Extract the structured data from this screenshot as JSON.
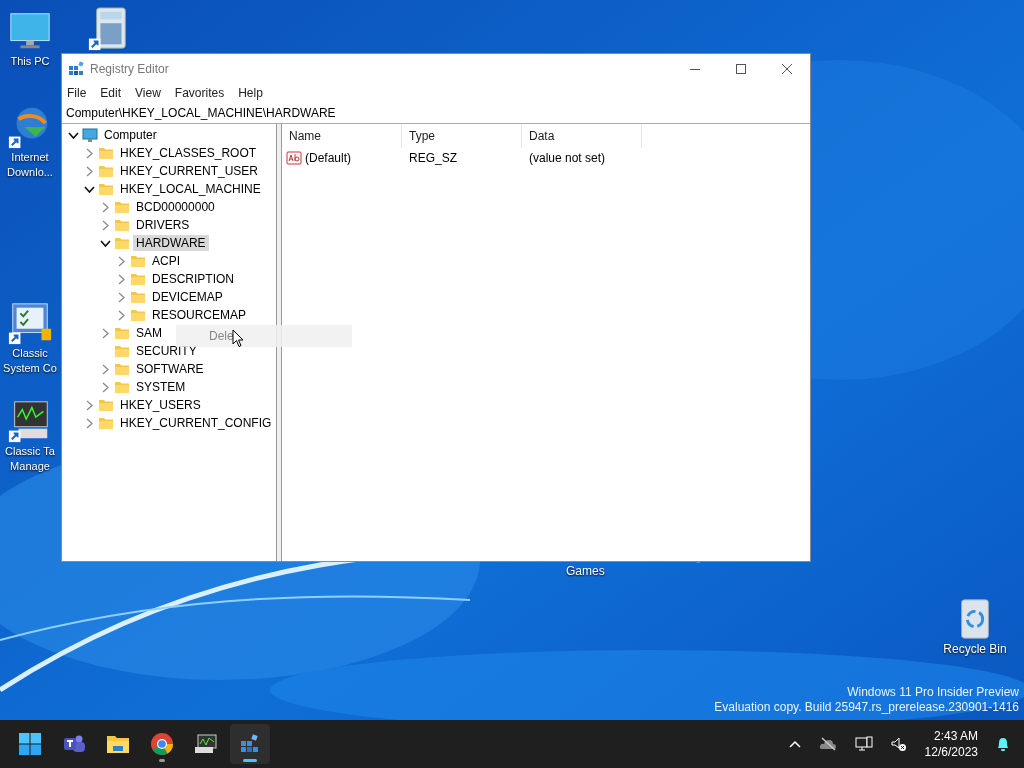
{
  "desktop_icons": [
    {
      "kind": "monitor",
      "lines": [
        "This PC"
      ]
    },
    {
      "kind": "calculator"
    },
    {
      "kind": "download",
      "lines": [
        "Internet",
        "Downlo..."
      ]
    },
    {
      "kind": "control",
      "lines": [
        "Classic",
        "System Co"
      ]
    },
    {
      "kind": "taskmgr",
      "lines": [
        "Classic Ta",
        "Manage"
      ]
    }
  ],
  "games_label": "Games",
  "recycle_bin": {
    "label": "Recycle Bin"
  },
  "watermark": [
    "Windows 11 Pro Insider Preview",
    "Evaluation copy. Build 25947.rs_prerelease.230901-1416"
  ],
  "window": {
    "title": "Registry Editor",
    "menu": [
      "File",
      "Edit",
      "View",
      "Favorites",
      "Help"
    ],
    "address": "Computer\\HKEY_LOCAL_MACHINE\\HARDWARE",
    "tree": {
      "items": [
        {
          "label": "Computer",
          "kind": "computer",
          "expanded": true,
          "selected": false,
          "children": [
            {
              "label": "HKEY_CLASSES_ROOT",
              "kind": "folder",
              "expanded": false,
              "selected": false
            },
            {
              "label": "HKEY_CURRENT_USER",
              "kind": "folder",
              "expanded": false,
              "selected": false
            },
            {
              "label": "HKEY_LOCAL_MACHINE",
              "kind": "folder",
              "expanded": true,
              "selected": false,
              "children": [
                {
                  "label": "BCD00000000",
                  "kind": "folder",
                  "expanded": false,
                  "selected": false
                },
                {
                  "label": "DRIVERS",
                  "kind": "folder",
                  "expanded": false,
                  "selected": false
                },
                {
                  "label": "HARDWARE",
                  "kind": "folder",
                  "expanded": true,
                  "selected": true,
                  "children": [
                    {
                      "label": "ACPI",
                      "kind": "folder",
                      "expanded": false,
                      "selected": false
                    },
                    {
                      "label": "DESCRIPTION",
                      "kind": "folder",
                      "expanded": false,
                      "selected": false
                    },
                    {
                      "label": "DEVICEMAP",
                      "kind": "folder",
                      "expanded": false,
                      "selected": false
                    },
                    {
                      "label": "RESOURCEMAP",
                      "kind": "folder",
                      "expanded": false,
                      "selected": false
                    }
                  ]
                },
                {
                  "label": "SAM",
                  "kind": "folder",
                  "expanded": false,
                  "selected": false
                },
                {
                  "label": "SECURITY",
                  "kind": "leaf",
                  "selected": false
                },
                {
                  "label": "SOFTWARE",
                  "kind": "folder",
                  "expanded": false,
                  "selected": false
                },
                {
                  "label": "SYSTEM",
                  "kind": "folder",
                  "expanded": false,
                  "selected": false
                }
              ]
            },
            {
              "label": "HKEY_USERS",
              "kind": "folder",
              "expanded": false,
              "selected": false
            },
            {
              "label": "HKEY_CURRENT_CONFIG",
              "kind": "folder",
              "expanded": false,
              "selected": false
            }
          ]
        }
      ]
    },
    "drag_ghost": {
      "text": "Dele"
    },
    "table": {
      "columns": [
        "Name",
        "Type",
        "Data"
      ],
      "rows": [
        {
          "kind": "string",
          "cells": [
            "(Default)",
            "REG_SZ",
            "(value not set)"
          ]
        }
      ]
    }
  },
  "taskbar": {
    "apps": [
      {
        "kind": "start",
        "running": false,
        "active": false
      },
      {
        "kind": "teams",
        "running": false,
        "active": false
      },
      {
        "kind": "explorer",
        "running": false,
        "active": false
      },
      {
        "kind": "chrome",
        "running": true,
        "active": false
      },
      {
        "kind": "taskmgr",
        "running": false,
        "active": false
      },
      {
        "kind": "regedit",
        "running": true,
        "active": true
      }
    ],
    "time": "2:43 AM",
    "date": "12/6/2023"
  }
}
